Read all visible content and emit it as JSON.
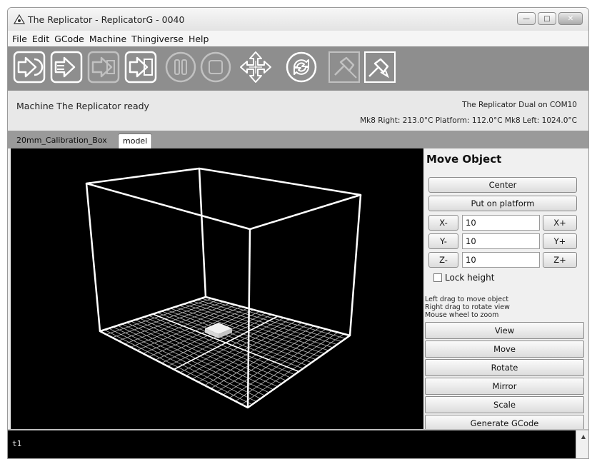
{
  "window": {
    "title": "The Replicator - ReplicatorG - 0040",
    "controls": {
      "minimize": "—",
      "maximize": "□",
      "close": "✕"
    }
  },
  "menu": [
    "File",
    "Edit",
    "GCode",
    "Machine",
    "Thingiverse",
    "Help"
  ],
  "toolbar": [
    {
      "name": "build-icon"
    },
    {
      "name": "upload-icon"
    },
    {
      "name": "build-to-file-icon"
    },
    {
      "name": "build-from-file-icon"
    },
    {
      "name": "pause-icon"
    },
    {
      "name": "stop-icon"
    },
    {
      "name": "control-panel-icon"
    },
    {
      "name": "reset-icon"
    },
    {
      "name": "disconnect-icon"
    },
    {
      "name": "connect-icon"
    }
  ],
  "status": {
    "message": "Machine The Replicator ready",
    "connection": "The Replicator Dual on COM10",
    "temperatures": "Mk8 Right: 213.0°C  Platform: 112.0°C Mk8 Left: 1024.0°C"
  },
  "tabs": [
    {
      "label": "20mm_Calibration_Box",
      "active": false
    },
    {
      "label": "model",
      "active": true
    }
  ],
  "panel": {
    "title": "Move Object",
    "center_label": "Center",
    "platform_label": "Put on platform",
    "axes": [
      {
        "minus": "X-",
        "value": "10",
        "plus": "X+"
      },
      {
        "minus": "Y-",
        "value": "10",
        "plus": "Y+"
      },
      {
        "minus": "Z-",
        "value": "10",
        "plus": "Z+"
      }
    ],
    "lock_height_label": "Lock height",
    "hints": [
      "Left drag to move object",
      "Right drag to rotate view",
      "Mouse wheel to zoom"
    ],
    "modes": [
      "View",
      "Move",
      "Rotate",
      "Mirror",
      "Scale"
    ],
    "generate_label": "Generate GCode"
  },
  "console": {
    "lines": [
      "t1"
    ]
  },
  "colors": {
    "toolbar": "#8e8e8e",
    "viewport": "#000000",
    "wireframe": "#ffffff"
  }
}
